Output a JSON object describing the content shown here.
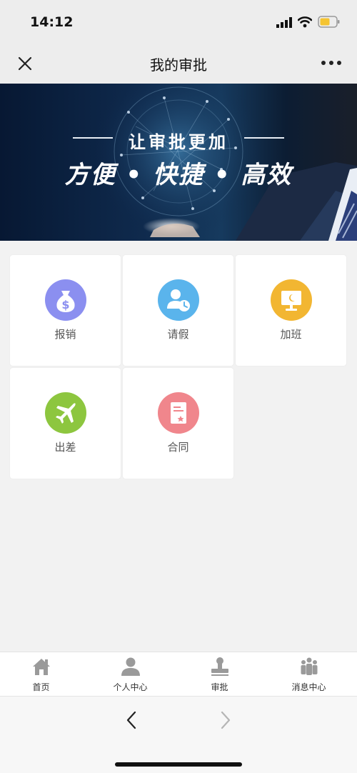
{
  "status": {
    "time": "14:12"
  },
  "navbar": {
    "title": "我的审批",
    "close_icon": "close-icon",
    "more_icon": "more-icon"
  },
  "banner": {
    "line1": "让审批更加",
    "line2": "方便 • 快捷 • 高效"
  },
  "grid": {
    "items": [
      {
        "label": "报销",
        "icon": "money-bag-icon",
        "color": "#8b8ff0"
      },
      {
        "label": "请假",
        "icon": "user-clock-icon",
        "color": "#5ab4ec"
      },
      {
        "label": "加班",
        "icon": "monitor-night-icon",
        "color": "#f2b632"
      },
      {
        "label": "出差",
        "icon": "airplane-icon",
        "color": "#8dc63f"
      },
      {
        "label": "合同",
        "icon": "contract-icon",
        "color": "#f0868c"
      }
    ]
  },
  "tabbar": {
    "items": [
      {
        "label": "首页",
        "icon": "home-icon"
      },
      {
        "label": "个人中心",
        "icon": "person-icon"
      },
      {
        "label": "审批",
        "icon": "stamp-icon"
      },
      {
        "label": "消息中心",
        "icon": "group-icon"
      }
    ]
  },
  "browser": {
    "back_icon": "chevron-left-icon",
    "forward_icon": "chevron-right-icon"
  }
}
